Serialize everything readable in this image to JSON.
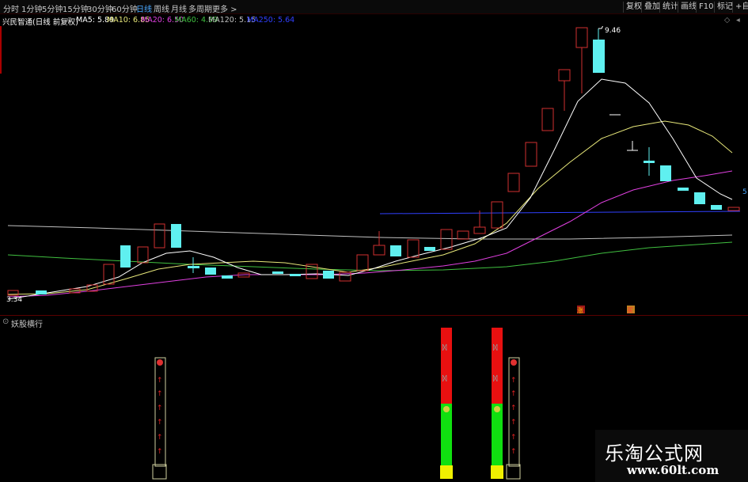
{
  "toolbar": {
    "timeframes": [
      "分时",
      "1分钟",
      "5分钟",
      "15分钟",
      "30分钟",
      "60分钟",
      "日线",
      "周线",
      "月线",
      "多周期",
      "更多 >"
    ],
    "active_timeframe": "日线",
    "right_buttons": [
      "复权",
      "叠加",
      "统计",
      "画线",
      "F10",
      "标记",
      "+自选"
    ]
  },
  "info": {
    "stock_name": "兴民智通(日线 前复权)",
    "ma5": "MA5: 5.89",
    "ma10": "MA10: 6.85",
    "ma20": "MA20: 6.50",
    "ma60": "MA60: 4.99",
    "ma120": "MA120: 5.15",
    "ma250": "MA250: 5.64"
  },
  "colors": {
    "up_candle": "#d03030",
    "down_candle": "#5ff0f0",
    "ma5": "#ffffff",
    "ma10": "#e8e87a",
    "ma20": "#e040e0",
    "ma60": "#40c040",
    "ma120": "#c0c0c0",
    "ma250": "#3040ff"
  },
  "chart": {
    "high_label": "9.46",
    "low_label": "3.34",
    "right_price_label": "5",
    "marker_zhang": "涨",
    "marker_mai": "买"
  },
  "sub_chart": {
    "title": "妖股横行"
  },
  "watermark": {
    "title": "乐淘公式网",
    "url": "www.60lt.com"
  }
}
